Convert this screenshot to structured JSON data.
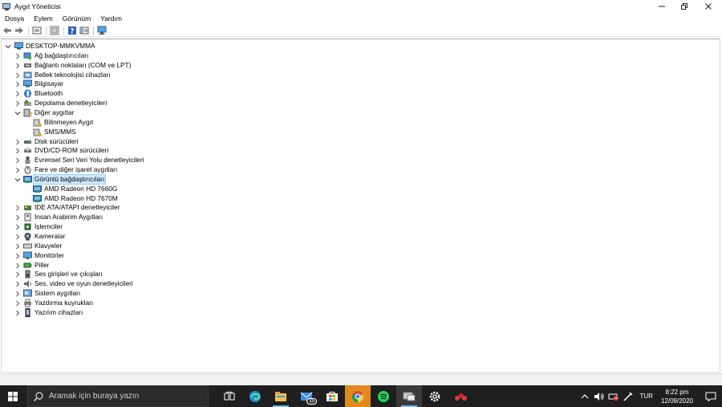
{
  "window": {
    "title": "Aygıt Yöneticisi",
    "controls": [
      "minimize",
      "restore",
      "close"
    ]
  },
  "menu": [
    "Dosya",
    "Eylem",
    "Görünüm",
    "Yardım"
  ],
  "toolbar": {
    "buttons": [
      "back-arrow-icon",
      "forward-arrow-icon",
      "properties-icon",
      "update-driver-icon",
      "help-icon",
      "view-icon",
      "monitor-icon"
    ]
  },
  "tree": {
    "root": "DESKTOP-MMKVMMA",
    "nodes": [
      {
        "label": "Ağ bağdaştırıcıları",
        "icon": "network-adapter-icon",
        "expanded": false,
        "level": 1
      },
      {
        "label": "Bağlantı noktaları (COM ve LPT)",
        "icon": "port-icon",
        "expanded": false,
        "level": 1
      },
      {
        "label": "Bellek teknolojisi cihazları",
        "icon": "memory-tech-icon",
        "expanded": false,
        "level": 1
      },
      {
        "label": "Bilgisayar",
        "icon": "computer-icon",
        "expanded": false,
        "level": 1
      },
      {
        "label": "Bluetooth",
        "icon": "bluetooth-icon",
        "expanded": false,
        "level": 1
      },
      {
        "label": "Depolama denetleyicileri",
        "icon": "storage-controller-icon",
        "expanded": false,
        "level": 1
      },
      {
        "label": "Diğer aygıtlar",
        "icon": "other-devices-icon",
        "expanded": true,
        "level": 1
      },
      {
        "label": "Bilinmeyen Aygıt",
        "icon": "unknown-device-icon",
        "level": 2
      },
      {
        "label": "SMS/MMS",
        "icon": "unknown-device-icon",
        "level": 2
      },
      {
        "label": "Disk sürücüleri",
        "icon": "disk-drive-icon",
        "expanded": false,
        "level": 1
      },
      {
        "label": "DVD/CD-ROM sürücüleri",
        "icon": "dvd-drive-icon",
        "expanded": false,
        "level": 1
      },
      {
        "label": "Evrensel Seri Veri Yolu denetleyicileri",
        "icon": "usb-icon",
        "expanded": false,
        "level": 1
      },
      {
        "label": "Fare ve diğer işaret aygıtları",
        "icon": "mouse-icon",
        "expanded": false,
        "level": 1
      },
      {
        "label": "Görüntü bağdaştırıcıları",
        "icon": "display-adapter-icon",
        "expanded": true,
        "level": 1,
        "selected": true
      },
      {
        "label": "AMD Radeon HD 7660G",
        "icon": "display-adapter-icon",
        "level": 2
      },
      {
        "label": "AMD Radeon HD 7670M",
        "icon": "display-adapter-icon",
        "level": 2
      },
      {
        "label": "IDE ATA/ATAPI denetleyiciler",
        "icon": "ide-controller-icon",
        "expanded": false,
        "level": 1
      },
      {
        "label": "İnsan Arabirim Aygıtları",
        "icon": "hid-icon",
        "expanded": false,
        "level": 1
      },
      {
        "label": "İşlemciler",
        "icon": "processor-icon",
        "expanded": false,
        "level": 1
      },
      {
        "label": "Kameralar",
        "icon": "camera-icon",
        "expanded": false,
        "level": 1
      },
      {
        "label": "Klavyeler",
        "icon": "keyboard-icon",
        "expanded": false,
        "level": 1
      },
      {
        "label": "Monitörler",
        "icon": "monitor-icon",
        "expanded": false,
        "level": 1
      },
      {
        "label": "Piller",
        "icon": "battery-icon",
        "expanded": false,
        "level": 1
      },
      {
        "label": "Ses girişleri ve çıkışları",
        "icon": "audio-io-icon",
        "expanded": false,
        "level": 1
      },
      {
        "label": "Ses, video ve oyun denetleyicileri",
        "icon": "sound-controller-icon",
        "expanded": false,
        "level": 1
      },
      {
        "label": "Sistem aygıtları",
        "icon": "system-devices-icon",
        "expanded": false,
        "level": 1
      },
      {
        "label": "Yazdırma kuyrukları",
        "icon": "printer-icon",
        "expanded": false,
        "level": 1
      },
      {
        "label": "Yazılım cihazları",
        "icon": "software-device-icon",
        "expanded": false,
        "level": 1
      }
    ]
  },
  "taskbar": {
    "search_placeholder": "Aramak için buraya yazın",
    "apps": [
      "task-view-icon",
      "edge-icon",
      "file-explorer-icon",
      "mail-icon",
      "store-icon",
      "chrome-icon",
      "spotify-icon",
      "device-manager-icon",
      "settings-icon",
      "paint-icon"
    ],
    "mail_badge": "15",
    "language": "TUR",
    "time": "8:22 pm",
    "date": "12/09/2020"
  },
  "colors": {
    "selection": "#cce8ff",
    "taskbar": "#1f1f1f",
    "accent": "#76b9ed"
  }
}
